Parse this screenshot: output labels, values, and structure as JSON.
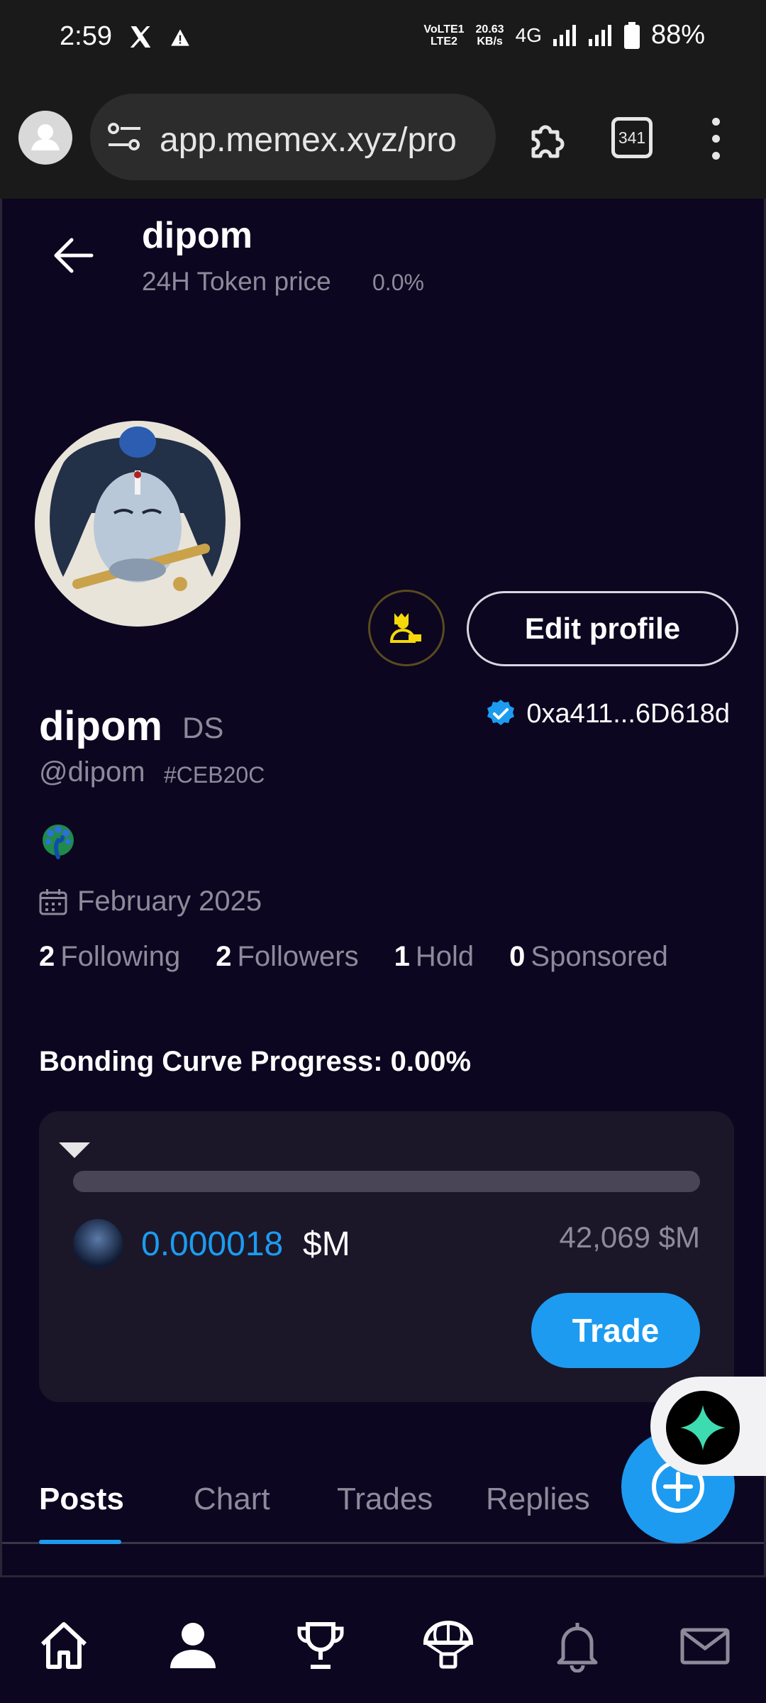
{
  "status_bar": {
    "time": "2:59",
    "network_top": "VoLTE1",
    "network_bottom": "LTE2",
    "speed_value": "20.63",
    "speed_unit": "KB/s",
    "net_type": "4G",
    "battery": "88%"
  },
  "browser": {
    "url": "app.memex.xyz/pro",
    "tab_count": "341"
  },
  "header": {
    "title": "dipom",
    "subtitle": "24H Token price",
    "change": "0.0%"
  },
  "profile": {
    "name": "dipom",
    "tag": "DS",
    "handle": "@dipom",
    "code": "#CEB20C",
    "wallet": "0xa411...6D618d",
    "bio_emoji": "🦚",
    "joined": "February 2025",
    "edit_label": "Edit profile",
    "stats": [
      {
        "value": "2",
        "label": "Following"
      },
      {
        "value": "2",
        "label": "Followers"
      },
      {
        "value": "1",
        "label": "Hold"
      },
      {
        "value": "0",
        "label": "Sponsored"
      }
    ]
  },
  "bonding": {
    "title": "Bonding Curve Progress: 0.00%",
    "progress": 0.0,
    "price": "0.000018",
    "price_unit": "$M",
    "market_cap": "42,069 $M",
    "trade_label": "Trade"
  },
  "tabs": [
    {
      "label": "Posts",
      "active": true
    },
    {
      "label": "Chart",
      "active": false
    },
    {
      "label": "Trades",
      "active": false
    },
    {
      "label": "Replies",
      "active": false
    }
  ],
  "bottom_nav": [
    "home-icon",
    "profile-icon",
    "trophy-icon",
    "airdrop-icon",
    "bell-icon",
    "mail-icon"
  ],
  "colors": {
    "accent": "#1d9bf0",
    "background": "#0c0620",
    "card": "#1b1729",
    "muted": "#8e8a9a",
    "badge_gold": "#f5d90a"
  }
}
